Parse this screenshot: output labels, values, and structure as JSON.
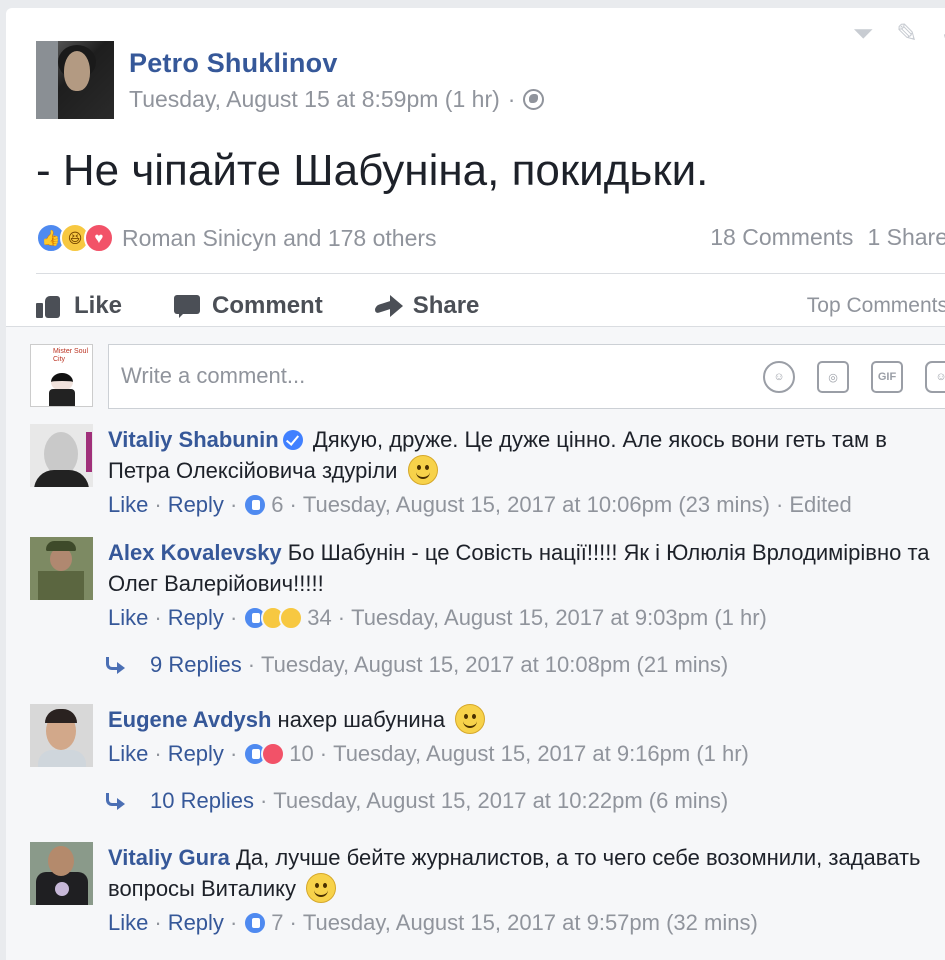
{
  "post": {
    "author": "Petro Shuklinov",
    "timestamp": "Tuesday, August 15 at 8:59pm (1 hr)",
    "separator": "·",
    "privacy_icon": "globe-icon",
    "text": "- Не чіпайте Шабуніна, покидьки.",
    "reactions": {
      "icons": [
        "like",
        "haha",
        "love"
      ],
      "reactors": "Roman Sinicyn and 178 others",
      "comments": "18 Comments",
      "shares": "1 Share"
    },
    "actions": {
      "like": "Like",
      "comment": "Comment",
      "share": "Share",
      "sort": "Top Comments"
    }
  },
  "composer": {
    "placeholder": "Write a comment...",
    "icons": [
      "emoji-icon",
      "camera-icon",
      "gif-icon",
      "sticker-icon"
    ],
    "gif_label": "GIF"
  },
  "comments": [
    {
      "name": "Vitaliy Shabunin",
      "verified": true,
      "text": "Дякую, друже. Це дуже цінно. Але якось вони геть там в Петра Олексійовича здуріли",
      "like": "Like",
      "reply": "Reply",
      "reaction_count": "6",
      "time": "Tuesday, August 15, 2017 at 10:06pm (23 mins)",
      "edited": "Edited"
    },
    {
      "name": "Alex Kovalevsky",
      "text": "Бо Шабунін - це Совість нації!!!!! Як і Юлюлія Врлодимірівно та Олег Валерійович!!!!!",
      "like": "Like",
      "reply": "Reply",
      "reaction_count": "34",
      "time": "Tuesday, August 15, 2017 at 9:03pm (1 hr)",
      "replies": "9 Replies",
      "replies_time": "Tuesday, August 15, 2017 at 10:08pm (21 mins)"
    },
    {
      "name": "Eugene Avdysh",
      "text": "нахер шабунина",
      "like": "Like",
      "reply": "Reply",
      "reaction_count": "10",
      "time": "Tuesday, August 15, 2017 at 9:16pm (1 hr)",
      "replies": "10 Replies",
      "replies_time": "Tuesday, August 15, 2017 at 10:22pm (6 mins)"
    },
    {
      "name": "Vitaliy Gura",
      "text": "Да, лучше бейте журналистов, а то чего себе возомнили, задавать вопросы Виталику",
      "like": "Like",
      "reply": "Reply",
      "reaction_count": "7",
      "time": "Tuesday, August 15, 2017 at 9:57pm (32 mins)"
    }
  ],
  "colors": {
    "link": "#365899",
    "meta": "#90949c",
    "like_blue": "#4f8af0",
    "love_red": "#f25268",
    "haha_yellow": "#f7c841"
  }
}
